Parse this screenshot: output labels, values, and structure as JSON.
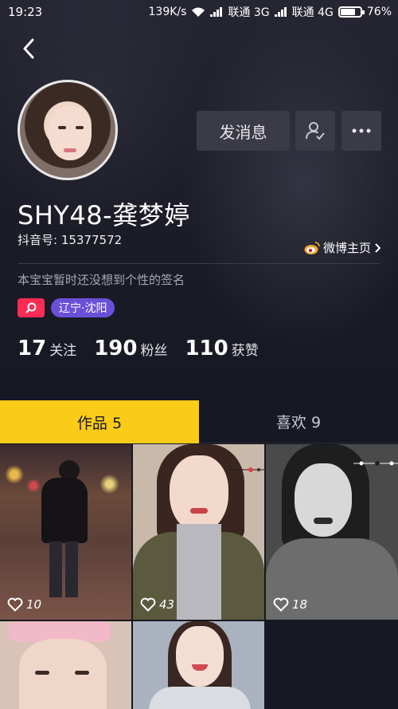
{
  "status_bar": {
    "time": "19:23",
    "speed": "139K/s",
    "carrier1": "联通 3G",
    "carrier2": "联通 4G",
    "battery": "76%",
    "battery_level": 0.76
  },
  "profile": {
    "name": "SHY48-龚梦婷",
    "douyin_id": "抖音号: 15377572",
    "weibo_label": "微博主页",
    "signature": "本宝宝暂时还没想到个性的签名",
    "location": "辽宁·沈阳",
    "message_button": "发消息"
  },
  "stats": [
    {
      "num": "17",
      "label": "关注"
    },
    {
      "num": "190",
      "label": "粉丝"
    },
    {
      "num": "110",
      "label": "获赞"
    }
  ],
  "tabs": [
    {
      "label": "作品 5"
    },
    {
      "label": "喜欢 9"
    }
  ],
  "videos": [
    {
      "likes": "10"
    },
    {
      "likes": "43"
    },
    {
      "likes": "18"
    },
    {
      "likes": ""
    },
    {
      "likes": ""
    }
  ],
  "colors": {
    "accent_yellow": "#facb18",
    "brand_pink": "#fe2c55",
    "location_purple": "#6a50d9",
    "background": "#161823"
  }
}
